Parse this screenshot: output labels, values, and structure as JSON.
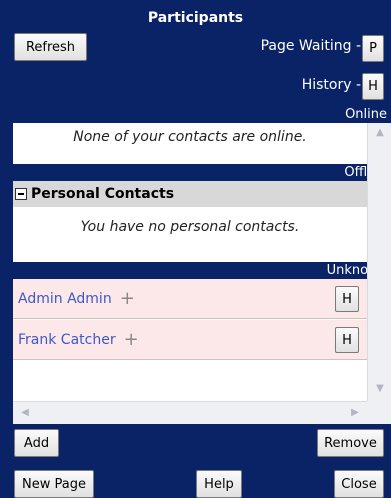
{
  "header": {
    "title": "Participants",
    "refresh_label": "Refresh",
    "page_waiting_label": "Page Waiting -",
    "page_waiting_button": "P",
    "history_label": "History -",
    "history_button": "H"
  },
  "sections": {
    "online": "Online",
    "offline": "Offline",
    "unknown": "Unknown"
  },
  "online_message": "None of your contacts are online.",
  "personal_contacts": {
    "title": "Personal Contacts",
    "message": "You have no personal contacts."
  },
  "contacts": [
    {
      "name": "Admin Admin",
      "plus": "+",
      "button": "H"
    },
    {
      "name": "Frank Catcher",
      "plus": "+",
      "button": "H"
    }
  ],
  "footer": {
    "add_label": "Add",
    "remove_label": "Remove",
    "new_page_label": "New Page",
    "help_label": "Help",
    "close_label": "Close"
  },
  "colors": {
    "frame": "#0a2366",
    "contact_row": "#fce8e8",
    "contact_name": "#3e58c8",
    "group_header": "#d8d8d8"
  }
}
